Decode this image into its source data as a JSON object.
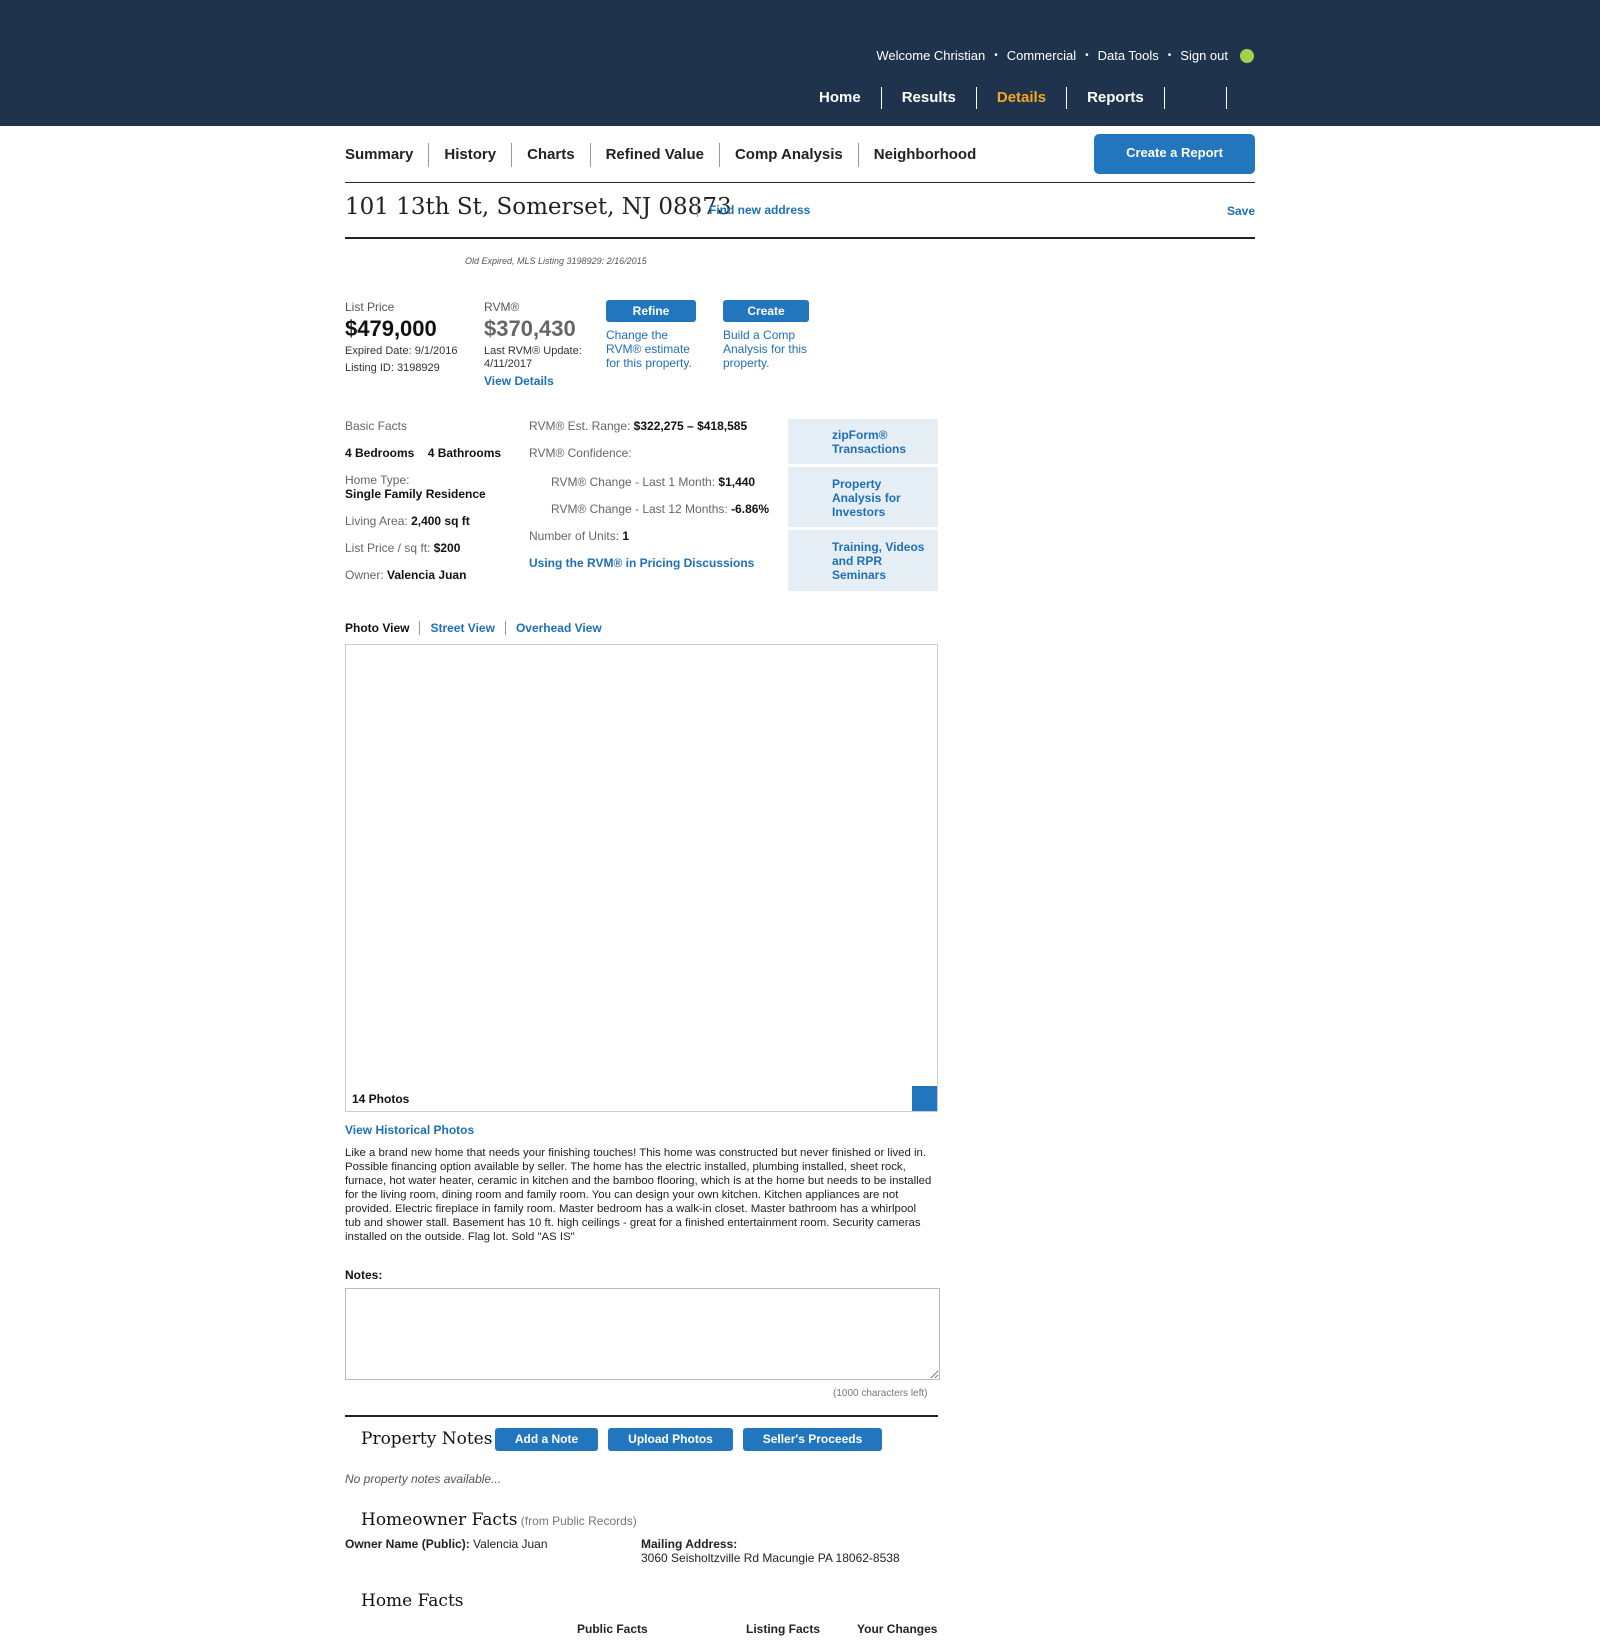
{
  "header": {
    "util": [
      "Welcome Christian",
      "Commercial",
      "Data Tools",
      "Sign out"
    ],
    "nav": [
      "Home",
      "Results",
      "Details",
      "Reports"
    ]
  },
  "subnav": {
    "tabs": [
      "Summary",
      "History",
      "Charts",
      "Refined Value",
      "Comp Analysis",
      "Neighborhood"
    ],
    "create_report": "Create a Report"
  },
  "property": {
    "address": "101 13th St, Somerset, NJ 08873",
    "find_new": "Find new address",
    "save": "Save",
    "mls_line": "Old Expired, MLS Listing 3198929: 2/16/2015"
  },
  "price": {
    "list_label": "List Price",
    "list_value": "$479,000",
    "expired": "Expired Date: 9/1/2016",
    "listing_id": "Listing ID: 3198929",
    "rvm_label": "RVM®",
    "rvm_value": "$370,430",
    "rvm_update": "Last RVM® Update:",
    "rvm_update_date": "4/11/2017",
    "view_details": "View Details",
    "refine_btn": "Refine",
    "refine_l1": "Change the",
    "refine_l2": "RVM® estimate",
    "refine_l3": "for this property.",
    "create_btn": "Create",
    "create_l1": "Build a Comp",
    "create_l2": "Analysis for this",
    "create_l3": "property."
  },
  "facts": {
    "basic_label": "Basic Facts",
    "bedrooms": "4 Bedrooms",
    "bathrooms": "4 Bathrooms",
    "home_type_label": "Home Type:",
    "home_type": "Single Family Residence",
    "living_label": "Living Area:",
    "living_value": "2,400 sq ft",
    "ppsf_label": "List Price / sq ft:",
    "ppsf_value": "$200",
    "owner_label": "Owner:",
    "owner_value": "Valencia Juan",
    "range_label": "RVM® Est. Range:",
    "range_value": "$322,275 – $418,585",
    "confidence_label": "RVM® Confidence:",
    "change1_label": "RVM® Change - Last 1 Month:",
    "change1_value": "$1,440",
    "change12_label": "RVM® Change - Last 12 Months:",
    "change12_value": "-6.86%",
    "units_label": "Number of Units:",
    "units_value": "1",
    "pricing_link": "Using the RVM® in Pricing Discussions"
  },
  "side_links": [
    [
      "zipForm®",
      "Transactions"
    ],
    [
      "Property",
      "Analysis for",
      "Investors"
    ],
    [
      "Training, Videos",
      "and RPR",
      "Seminars"
    ]
  ],
  "photo": {
    "tabs": [
      "Photo View",
      "Street View",
      "Overhead View"
    ],
    "count": "14 Photos",
    "historical": "View Historical Photos"
  },
  "description": "Like a brand new home that needs your finishing touches! This home was constructed but never finished or lived in. Possible financing option available by seller. The home has the electric installed, plumbing installed, sheet rock, furnace, hot water heater, ceramic in kitchen and the bamboo flooring, which is at the home but needs to be installed for the living room, dining room and family room. You can design your own kitchen. Kitchen appliances are not provided. Electric fireplace in family room. Master bedroom has a walk-in closet. Master bathroom has a whirlpool tub and shower stall. Basement has 10 ft. high ceilings - great for a finished entertainment room. Security cameras installed on the outside. Flag lot. Sold \"AS IS\"",
  "notes": {
    "label": "Notes:",
    "chars_left": "(1000 characters left)"
  },
  "property_notes": {
    "title": "Property Notes",
    "buttons": [
      "Add a Note",
      "Upload Photos",
      "Seller's Proceeds"
    ],
    "empty": "No property notes available..."
  },
  "homeowner": {
    "title": "Homeowner Facts",
    "subtitle": "(from Public Records)",
    "owner_label": "Owner Name (Public):",
    "owner_value": "Valencia Juan",
    "mailing_label": "Mailing Address:",
    "mailing_value": "3060 Seisholtzville Rd Macungie PA 18062-8538"
  },
  "home_facts": {
    "title": "Home Facts",
    "columns": [
      "Public Facts",
      "Listing Facts",
      "Your Changes"
    ]
  },
  "colors": {
    "header_bg": "#1f344c",
    "accent_blue": "#2176bd",
    "active_nav": "#f5a623",
    "status_dot": "#a6d04b"
  }
}
